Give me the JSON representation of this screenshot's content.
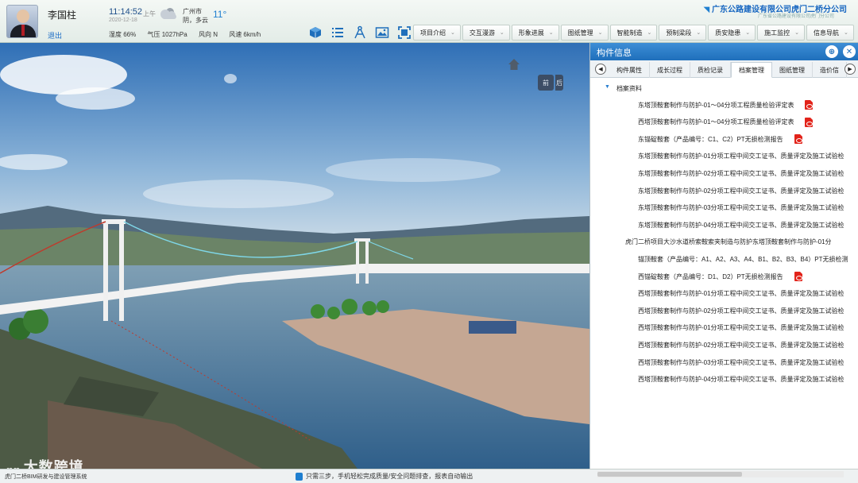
{
  "user": {
    "name": "李国柱",
    "logout": "退出"
  },
  "time": {
    "clock": "11:14:52",
    "ampm": "上午",
    "date": "2020-12-18"
  },
  "weather": {
    "city": "广州市",
    "condition": "阴，多云",
    "temperature": "11°",
    "humidity": "湿度 66%",
    "pressure": "气压 1027hPa",
    "wind_dir": "风向 N",
    "wind_speed": "风速 6km/h"
  },
  "company": {
    "name": "广东公路建设有限公司虎门二桥分公司",
    "sub": "广东省公路建设有限公司虎门分公司"
  },
  "toolbar_icons": [
    "cube-icon",
    "list-icon",
    "measure-icon",
    "image-icon",
    "fullscreen-icon"
  ],
  "nav": [
    {
      "label": "项目介绍"
    },
    {
      "label": "交互漫游"
    },
    {
      "label": "形象进展"
    },
    {
      "label": "图纸管理"
    },
    {
      "label": "智能制造"
    },
    {
      "label": "预制梁段"
    },
    {
      "label": "质安隐患"
    },
    {
      "label": "施工监控"
    },
    {
      "label": "信息导航"
    }
  ],
  "viewport": {
    "front": "前",
    "back": "后",
    "watermark": "大数跨境"
  },
  "panel": {
    "title": "构件信息",
    "tabs": [
      "构件属性",
      "成长过程",
      "质检记录",
      "档案管理",
      "图纸管理",
      "造价信"
    ],
    "active_tab": "档案管理",
    "root": "档案资料",
    "items": [
      {
        "text": "东塔顶鞍套制作与防护-01～04分项工程质量检验评定表",
        "pdf": true
      },
      {
        "text": "西塔顶鞍套制作与防护-01～04分项工程质量检验评定表",
        "pdf": true
      },
      {
        "text": "东锚碇鞍套（产品编号：C1、C2）PT无损检测报告",
        "pdf": true
      },
      {
        "text": "东塔顶鞍套制作与防护-01分项工程中间交工证书、质量评定及施工试验检",
        "pdf": false
      },
      {
        "text": "东塔顶鞍套制作与防护-02分项工程中间交工证书、质量评定及施工试验检",
        "pdf": false
      },
      {
        "text": "东塔顶鞍套制作与防护-02分项工程中间交工证书、质量评定及施工试验检",
        "pdf": false
      },
      {
        "text": "东塔顶鞍套制作与防护-03分项工程中间交工证书、质量评定及施工试验检",
        "pdf": false
      },
      {
        "text": "东塔顶鞍套制作与防护-04分项工程中间交工证书、质量评定及施工试验检",
        "pdf": false
      },
      {
        "text": "虎门二桥项目大沙水道桥索鞍索夹制造与防护东塔顶鞍套制作与防护-01分",
        "pdf": false
      },
      {
        "text": "锚顶鞍套（产品编号：A1、A2、A3、A4、B1、B2、B3、B4）PT无损检测",
        "pdf": false
      },
      {
        "text": "西锚碇鞍套（产品编号：D1、D2）PT无损检测报告",
        "pdf": true
      },
      {
        "text": "西塔顶鞍套制作与防护-01分项工程中间交工证书、质量评定及施工试验检",
        "pdf": false
      },
      {
        "text": "西塔顶鞍套制作与防护-02分项工程中间交工证书、质量评定及施工试验检",
        "pdf": false
      },
      {
        "text": "西塔顶鞍套制作与防护-01分项工程中间交工证书、质量评定及施工试验检",
        "pdf": false
      },
      {
        "text": "西塔顶鞍套制作与防护-02分项工程中间交工证书、质量评定及施工试验检",
        "pdf": false
      },
      {
        "text": "西塔顶鞍套制作与防护-03分项工程中间交工证书、质量评定及施工试验检",
        "pdf": false
      },
      {
        "text": "西塔顶鞍套制作与防护-04分项工程中间交工证书、质量评定及施工试验检",
        "pdf": false
      }
    ]
  },
  "status": {
    "left": "虎门二桥BIM研发与建设管理系统",
    "hint": "只需三步，手机轻松完成质量/安全问题排查，报表自动输出"
  }
}
